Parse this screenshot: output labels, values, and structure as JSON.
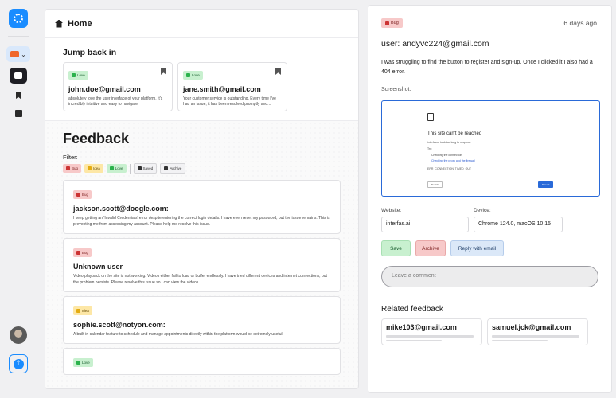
{
  "nav": {
    "items": [
      {
        "name": "feedback",
        "active": true
      },
      {
        "name": "saved",
        "active": false
      },
      {
        "name": "archive",
        "active": false
      }
    ]
  },
  "header": {
    "title": "Home"
  },
  "jump_back": {
    "title": "Jump back in",
    "cards": [
      {
        "tag": "Love",
        "email": "john.doe@gmail.com",
        "snippet": "absolutely love the user interface of your platform. It's incredibly intuitive and easy to navigate."
      },
      {
        "tag": "Love",
        "email": "jane.smith@gmail.com",
        "snippet": "Your customer service is outstanding. Every time I've had an issue, it has been resolved promptly and..."
      }
    ]
  },
  "feedback": {
    "title": "Feedback",
    "filter_label": "Filter:",
    "filters": [
      {
        "label": "Bug",
        "kind": "bug"
      },
      {
        "label": "Idea",
        "kind": "idea"
      },
      {
        "label": "Love",
        "kind": "love"
      },
      {
        "label": "Saved",
        "kind": "neutral"
      },
      {
        "label": "Archive",
        "kind": "neutral"
      }
    ],
    "items": [
      {
        "tag": "Bug",
        "kind": "bug",
        "name": "jackson.scott@doogle.com:",
        "text": "I keep getting an 'Invalid Credentials' error despite entering the correct login details. I have even reset my password, but the issue remains. This is preventing me from accessing my account. Please help me resolve this issue."
      },
      {
        "tag": "Bug",
        "kind": "bug",
        "name": "Unknown user",
        "text": "Video playback on the site is not working. Videos either fail to load or buffer endlessly. I have tried different devices and internet connections, but the problem persists. Please resolve this issue so I can view the videos."
      },
      {
        "tag": "Idea",
        "kind": "idea",
        "name": "sophie.scott@notyon.com:",
        "text": "A built-in calendar feature to schedule and manage appointments directly within the platform would be extremely useful."
      },
      {
        "tag": "Love",
        "kind": "love",
        "name": "",
        "text": ""
      }
    ]
  },
  "detail": {
    "tag": "Bug",
    "date": "6 days ago",
    "user": "user: andyvc224@gmail.com",
    "message": "I was struggling to find the button to register and sign-up. Once I clicked it I also had a 404 error.",
    "screenshot_label": "Screenshot:",
    "screenshot": {
      "title": "This site can't be reached",
      "line1": "interfas.ai took too long to respond.",
      "line2": "Try:",
      "bullets": [
        "Checking the connection",
        "Checking the proxy and the firewall"
      ],
      "code": "ERR_CONNECTION_TIMED_OUT",
      "btn_details": "Details",
      "btn_reload": "Reload"
    },
    "website_label": "Website:",
    "website": "interfas.ai",
    "device_label": "Device:",
    "device": "Chrome 124.0, macOS 10.15",
    "actions": {
      "save": "Save",
      "archive": "Archive",
      "reply": "Reply with email"
    },
    "comment_placeholder": "Leave a comment",
    "related_title": "Related feedback",
    "related": [
      {
        "email": "mike103@gmail.com"
      },
      {
        "email": "samuel.jck@gmail.com"
      }
    ]
  },
  "colors": {
    "accent": "#1a8cff",
    "bug": "#f7c9c9",
    "idea": "#fde7a6",
    "love": "#c8f0cf",
    "reply": "#dbe8f8"
  }
}
